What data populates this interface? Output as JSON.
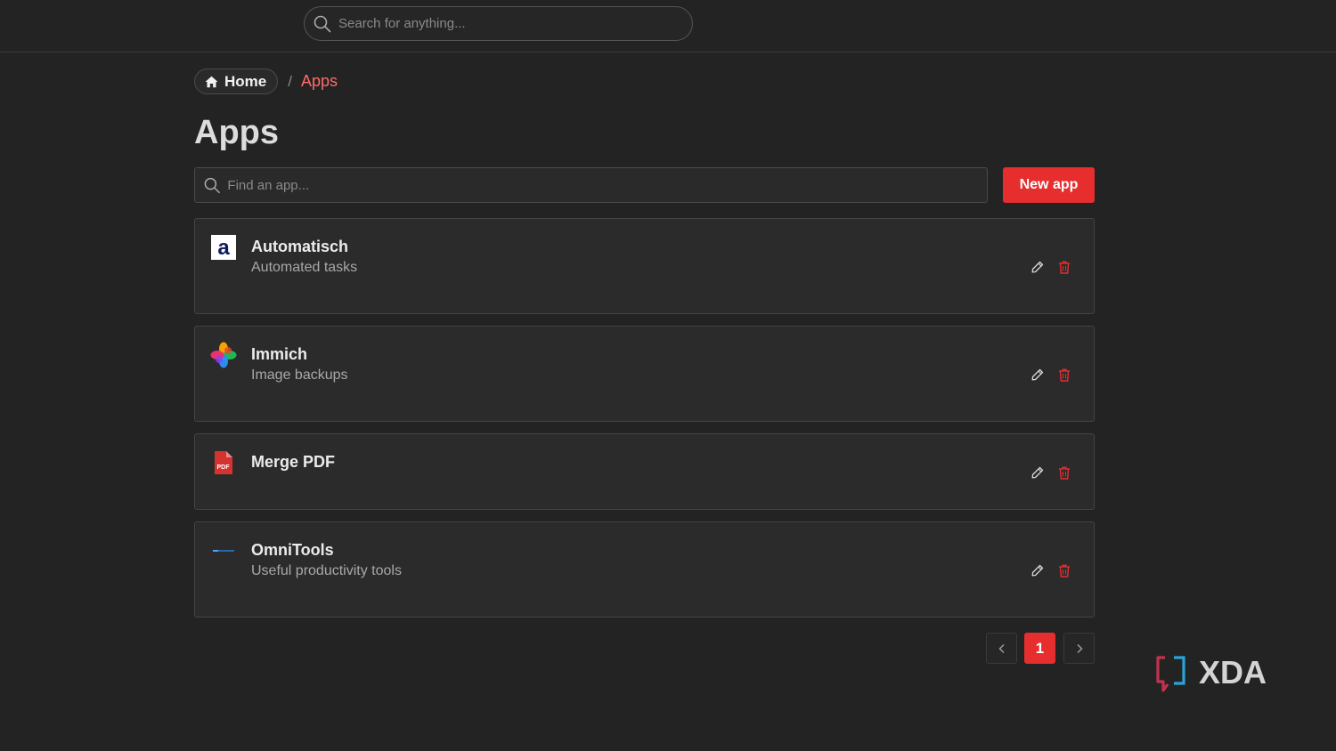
{
  "topbar": {
    "search_placeholder": "Search for anything..."
  },
  "breadcrumb": {
    "home_label": "Home",
    "separator": "/",
    "current_label": "Apps"
  },
  "page": {
    "title": "Apps"
  },
  "toolbar": {
    "find_placeholder": "Find an app...",
    "new_app_label": "New app"
  },
  "apps": [
    {
      "name": "Automatisch",
      "description": "Automated tasks",
      "logo": "automatisch-logo-icon"
    },
    {
      "name": "Immich",
      "description": "Image backups",
      "logo": "immich-logo-icon"
    },
    {
      "name": "Merge PDF",
      "description": "",
      "logo": "pdf-file-icon"
    },
    {
      "name": "OmniTools",
      "description": "Useful productivity tools",
      "logo": "omnitools-logo-icon"
    }
  ],
  "pagination": {
    "prev_icon": "chevron-left-icon",
    "current_page": "1",
    "next_icon": "chevron-right-icon"
  },
  "colors": {
    "accent": "#e62e2e",
    "breadcrumb_current": "#ff6b6b",
    "background": "#232323"
  },
  "watermark": {
    "text": "XDA"
  }
}
